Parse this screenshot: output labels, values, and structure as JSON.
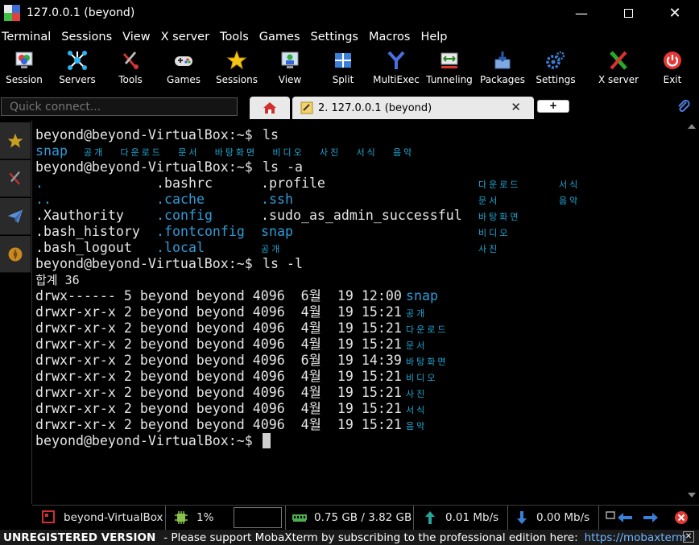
{
  "window": {
    "title": "127.0.0.1 (beyond)"
  },
  "menu": [
    "Terminal",
    "Sessions",
    "View",
    "X server",
    "Tools",
    "Games",
    "Settings",
    "Macros",
    "Help"
  ],
  "toolbar": [
    {
      "label": "Session",
      "icon": "session-icon"
    },
    {
      "label": "Servers",
      "icon": "servers-icon"
    },
    {
      "label": "Tools",
      "icon": "tools-icon"
    },
    {
      "label": "Games",
      "icon": "gamepad-icon"
    },
    {
      "label": "Sessions",
      "icon": "star-icon"
    },
    {
      "label": "View",
      "icon": "view-icon"
    },
    {
      "label": "Split",
      "icon": "split-icon"
    },
    {
      "label": "MultiExec",
      "icon": "multiexec-icon"
    },
    {
      "label": "Tunneling",
      "icon": "tunneling-icon"
    },
    {
      "label": "Packages",
      "icon": "packages-icon"
    },
    {
      "label": "Settings",
      "icon": "settings-gears-icon"
    },
    {
      "label": "X server",
      "icon": "x-server-icon"
    },
    {
      "label": "Exit",
      "icon": "power-icon"
    }
  ],
  "quick_connect": {
    "placeholder": "Quick connect..."
  },
  "tabs": {
    "session_label": "2. 127.0.0.1 (beyond)"
  },
  "terminal": {
    "prompt": "beyond@beyond-VirtualBox:~$ ",
    "cmd1": "ls",
    "ls": {
      "snap": "snap",
      "korean": "공개  다운로드  문서  바탕화면  비디오  사진  서식  음악"
    },
    "cmd2": "ls -a",
    "lsa": {
      "row1": {
        "a": ".",
        "b": ".bashrc",
        "c": ".profile",
        "k1": "다운로드",
        "k2": "서식"
      },
      "row2": {
        "a": "..",
        "b": ".cache",
        "c": ".ssh",
        "k1": "문서",
        "k2": "음악"
      },
      "row3": {
        "a": ".Xauthority",
        "b": ".config",
        "c": ".sudo_as_admin_successful",
        "k1": "바탕화면"
      },
      "row4": {
        "a": ".bash_history",
        "b": ".fontconfig",
        "c": "snap",
        "k1": "비디오"
      },
      "row5": {
        "a": ".bash_logout",
        "b": ".local",
        "c": "공개",
        "k1": "사진"
      }
    },
    "cmd3": "ls -l",
    "total": "합계 36",
    "rows": [
      {
        "perm": "drwx------ 5 beyond beyond 4096  6월  19 12:00 ",
        "name": "snap",
        "kr": false
      },
      {
        "perm": "drwxr-xr-x 2 beyond beyond 4096  4월  19 15:21 ",
        "name": "공개",
        "kr": true
      },
      {
        "perm": "drwxr-xr-x 2 beyond beyond 4096  4월  19 15:21 ",
        "name": "다운로드",
        "kr": true
      },
      {
        "perm": "drwxr-xr-x 2 beyond beyond 4096  4월  19 15:21 ",
        "name": "문서",
        "kr": true
      },
      {
        "perm": "drwxr-xr-x 2 beyond beyond 4096  6월  19 14:39 ",
        "name": "바탕화면",
        "kr": true
      },
      {
        "perm": "drwxr-xr-x 2 beyond beyond 4096  4월  19 15:21 ",
        "name": "비디오",
        "kr": true
      },
      {
        "perm": "drwxr-xr-x 2 beyond beyond 4096  4월  19 15:21 ",
        "name": "사진",
        "kr": true
      },
      {
        "perm": "drwxr-xr-x 2 beyond beyond 4096  4월  19 15:21 ",
        "name": "서식",
        "kr": true
      },
      {
        "perm": "drwxr-xr-x 2 beyond beyond 4096  4월  19 15:21 ",
        "name": "음악",
        "kr": true
      }
    ]
  },
  "status": {
    "host": "beyond-VirtualBox",
    "cpu": "1%",
    "memory": "0.75 GB / 3.82 GB",
    "upload": "0.01 Mb/s",
    "download": "0.00 Mb/s"
  },
  "footer": {
    "unregistered": "UNREGISTERED VERSION",
    "message": "-  Please support MobaXterm by subscribing to the professional edition here:",
    "link": "https://mobaxterm"
  },
  "colors": {
    "dir_blue": "#2f9cd8",
    "fg": "#e6e6e6",
    "tab_bg": "#e9e9e9"
  }
}
